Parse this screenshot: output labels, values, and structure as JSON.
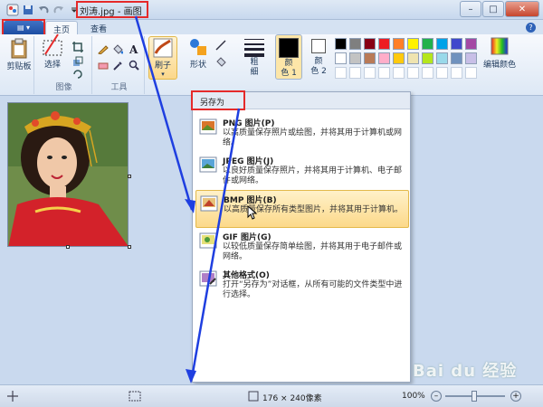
{
  "window": {
    "title": "刘涛.jpg - 画图",
    "buttons": [
      "–",
      "□",
      "✕"
    ]
  },
  "tabs": {
    "app_menu": "▤ ▾",
    "home": "主页",
    "view": "查看",
    "help": "?"
  },
  "ribbon": {
    "clipboard_label": "剪贴板",
    "select_label": "选择",
    "image_group": "图像",
    "tools_group": "工具",
    "brush_label": "刷子",
    "shapes_label": "形状",
    "size_label": "粗\n细",
    "color1_label": "颜\n色 1",
    "color2_label": "颜\n色 2",
    "edit_colors_label": "编辑颜色",
    "color1_value": "#000000",
    "color2_value": "#ffffff",
    "palette": [
      "#000000",
      "#7f7f7f",
      "#880015",
      "#ed1c24",
      "#ff7f27",
      "#fff200",
      "#22b14c",
      "#00a2e8",
      "#3f48cc",
      "#a349a4",
      "#ffffff",
      "#c3c3c3",
      "#b97a57",
      "#ffaec9",
      "#ffc90e",
      "#efe4b0",
      "#b5e61d",
      "#99d9ea",
      "#7092be",
      "#c8bfe7"
    ]
  },
  "menu": {
    "header": "另存为",
    "items": [
      {
        "title": "PNG 图片(P)",
        "desc": "以高质量保存照片或绘图，并将其用于计算机或网络。",
        "icon": "png-icon"
      },
      {
        "title": "JPEG 图片(J)",
        "desc": "以良好质量保存照片，并将其用于计算机、电子邮件或网络。",
        "icon": "jpeg-icon"
      },
      {
        "title": "BMP 图片(B)",
        "desc": "以高质量保存所有类型图片，并将其用于计算机。",
        "icon": "bmp-icon"
      },
      {
        "title": "GIF 图片(G)",
        "desc": "以较低质量保存简单绘图，并将其用于电子邮件或网络。",
        "icon": "gif-icon"
      },
      {
        "title": "其他格式(O)",
        "desc": "打开“另存为”对话框，从所有可能的文件类型中进行选择。",
        "icon": "other-formats-icon"
      }
    ]
  },
  "status": {
    "dimensions": "176 × 240像素",
    "zoom": "100%"
  },
  "watermark": "Bai du 经验"
}
